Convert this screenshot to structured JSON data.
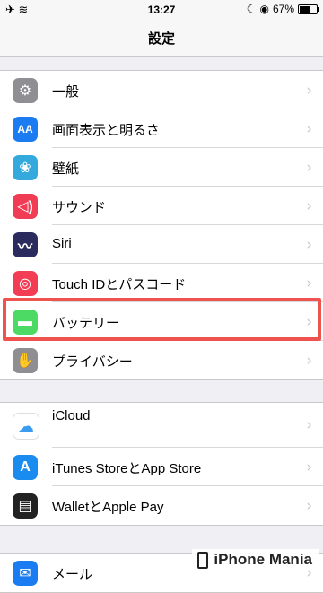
{
  "status_bar": {
    "time": "13:27",
    "battery_percent": "67%",
    "battery_level": 0.67
  },
  "nav": {
    "title": "設定"
  },
  "group1": [
    {
      "name": "row-general",
      "icon": "gear-icon",
      "color": "#8e8e93",
      "label": "一般"
    },
    {
      "name": "row-display",
      "icon": "text-size-icon",
      "color": "#1a7cf0",
      "label": "画面表示と明るさ"
    },
    {
      "name": "row-wallpaper",
      "icon": "flower-icon",
      "color": "#34aadc",
      "label": "壁紙"
    },
    {
      "name": "row-sounds",
      "icon": "speaker-icon",
      "color": "#f03c55",
      "label": "サウンド"
    },
    {
      "name": "row-siri",
      "icon": "siri-icon",
      "color": "#2b2b5e",
      "label": "Siri"
    },
    {
      "name": "row-touchid",
      "icon": "fingerprint-icon",
      "color": "#f23d55",
      "label": "Touch IDとパスコード"
    },
    {
      "name": "row-battery",
      "icon": "battery-icon",
      "color": "#4cd964",
      "label": "バッテリー"
    },
    {
      "name": "row-privacy",
      "icon": "hand-icon",
      "color": "#8e8e93",
      "label": "プライバシー"
    }
  ],
  "group2": [
    {
      "name": "row-icloud",
      "icon": "cloud-icon",
      "color": "#ffffff",
      "label": "iCloud"
    },
    {
      "name": "row-itunes",
      "icon": "app-store-icon",
      "color": "#1a8cf0",
      "label": "iTunes StoreとApp Store"
    },
    {
      "name": "row-wallet",
      "icon": "wallet-icon",
      "color": "#222222",
      "label": "WalletとApple Pay"
    }
  ],
  "group3": [
    {
      "name": "row-mail",
      "icon": "mail-icon",
      "color": "#1a7cf0",
      "label": "メール"
    }
  ],
  "watermark": {
    "brand": "iPhone Mania"
  }
}
